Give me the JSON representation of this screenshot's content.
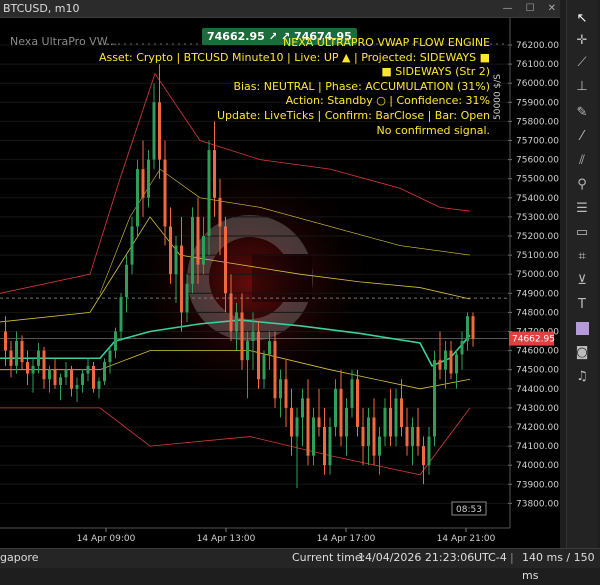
{
  "window": {
    "title": "BTCUSD, m10"
  },
  "legend": {
    "indicator": "Nexa UltraPro VW..."
  },
  "badges": {
    "left": "74662.95 ↗",
    "right": "↗ 74674.95"
  },
  "info": {
    "title": "NEXA ULTRAPRO VWAP FLOW ENGINE",
    "line1": "Asset: Crypto | BTCUSD Minute10 | Live: UP ▲ | Projected: SIDEWAYS ■",
    "line2": "■ SIDEWAYS (Str 2)",
    "line3": "Bias: NEUTRAL | Phase: ACCUMULATION (31%)",
    "line4": "Action: Standby ○ | Confidence: 31%",
    "line5": "Update: LiveTicks | Confirm: BarClose | Bar: Open",
    "line6": "No confirmed signal."
  },
  "price_axis": {
    "ticks": [
      "76200.00",
      "76100.00",
      "76000.00",
      "75900.00",
      "75800.00",
      "75700.00",
      "75600.00",
      "75500.00",
      "75400.00",
      "75300.00",
      "75200.00",
      "75100.00",
      "75000.00",
      "74900.00",
      "74800.00",
      "74700.00",
      "74600.00",
      "74500.00",
      "74400.00",
      "74300.00",
      "74200.00",
      "74100.00",
      "74000.00",
      "73900.00",
      "73800.00"
    ],
    "current_price": "74662.95",
    "scale_label": "50000 $/S"
  },
  "time_axis": {
    "ticks": [
      "14 Apr 09:00",
      "14 Apr 13:00",
      "14 Apr 17:00",
      "14 Apr 21:00"
    ],
    "countdown": "08:53"
  },
  "status": {
    "location": "gapore",
    "current_time_label": "Current time:",
    "current_time": "14/04/2026 21:23:06",
    "timezone": "UTC-4",
    "latency": "140 ms / 150 ms"
  },
  "colors": {
    "bull": "#2e9e58",
    "bear": "#ef6a3f",
    "vwap": "#3ad0a0",
    "outer_band": "#d93a3a",
    "inner_band": "#d8c33a",
    "badge": "#1c6b3a",
    "info_text": "#ffe62e"
  },
  "toolbar": {
    "icons": [
      "cursor-icon",
      "crosshair-icon",
      "trend-line-icon",
      "horizontal-line-icon",
      "pencil-icon",
      "brush-icon",
      "ray-icon",
      "fibonacci-icon",
      "channel-icon",
      "rectangle-icon",
      "label-icon",
      "projection-icon",
      "text-icon",
      "color-swatch-icon",
      "camera-icon",
      "alert-bell-icon"
    ]
  }
}
